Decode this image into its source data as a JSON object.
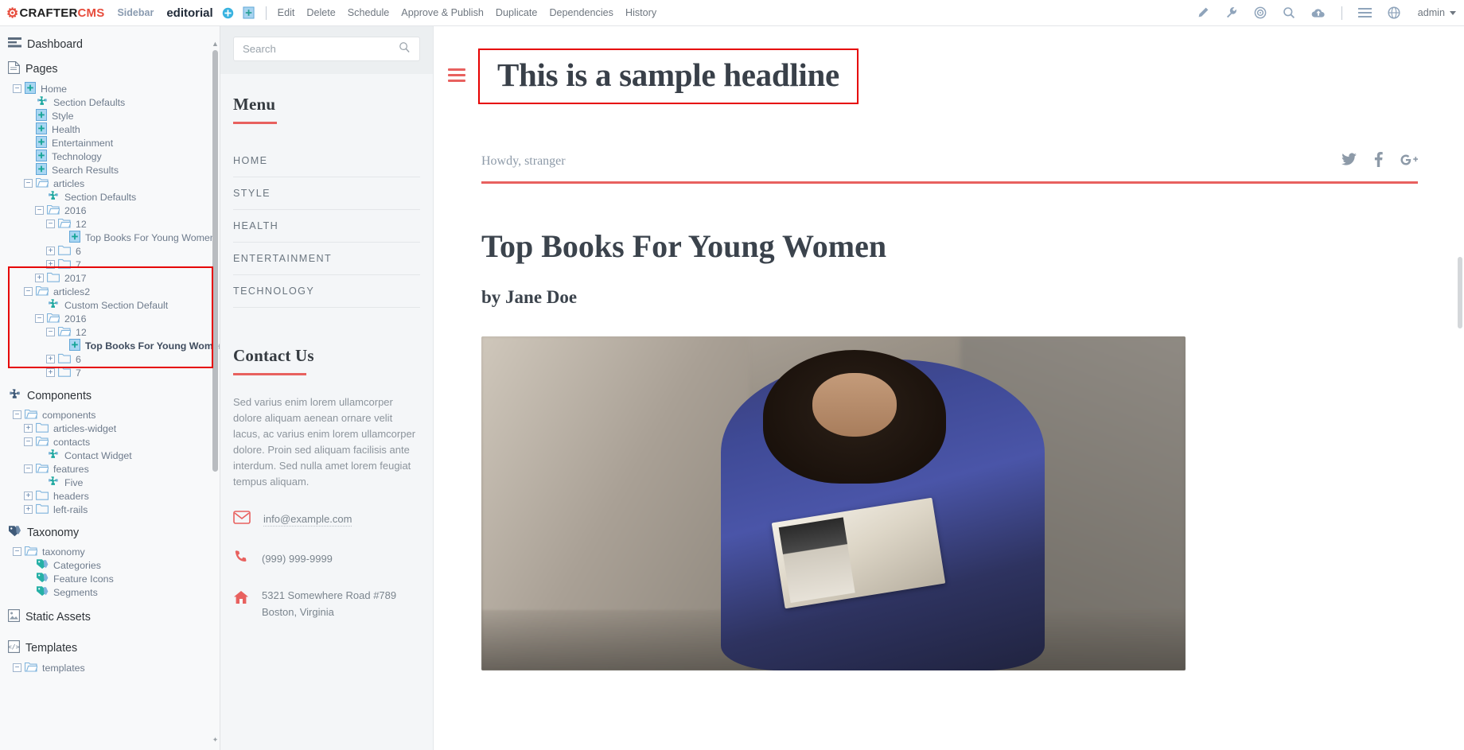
{
  "topbar": {
    "logo_crafter": "CRAFTER",
    "logo_cms": "CMS",
    "sidebar_label": "Sidebar",
    "site_name": "editorial",
    "add_icon": "circle-plus-icon",
    "new_page_icon": "new-page-icon",
    "menu": [
      "Edit",
      "Delete",
      "Schedule",
      "Approve & Publish",
      "Duplicate",
      "Dependencies",
      "History"
    ],
    "right_icons": [
      "pencil-icon",
      "wrench-icon",
      "target-icon",
      "search-icon",
      "cloud-upload-icon",
      "hamburger-icon",
      "globe-help-icon"
    ],
    "admin_label": "admin"
  },
  "tree": {
    "dashboard": "Dashboard",
    "pages_label": "Pages",
    "components_label": "Components",
    "taxonomy_label": "Taxonomy",
    "static_assets_label": "Static Assets",
    "templates_label": "Templates",
    "pages": [
      {
        "label": "Home",
        "depth": 1,
        "toggle": "minus",
        "icon": "page-icon"
      },
      {
        "label": "Section Defaults",
        "depth": 2,
        "toggle": "none",
        "icon": "component-icon"
      },
      {
        "label": "Style",
        "depth": 2,
        "toggle": "none",
        "icon": "page-icon"
      },
      {
        "label": "Health",
        "depth": 2,
        "toggle": "none",
        "icon": "page-icon"
      },
      {
        "label": "Entertainment",
        "depth": 2,
        "toggle": "none",
        "icon": "page-icon"
      },
      {
        "label": "Technology",
        "depth": 2,
        "toggle": "none",
        "icon": "page-icon"
      },
      {
        "label": "Search Results",
        "depth": 2,
        "toggle": "none",
        "icon": "page-icon"
      },
      {
        "label": "articles",
        "depth": 2,
        "toggle": "minus",
        "icon": "folder-open-icon"
      },
      {
        "label": "Section Defaults",
        "depth": 3,
        "toggle": "none",
        "icon": "component-icon"
      },
      {
        "label": "2016",
        "depth": 3,
        "toggle": "minus",
        "icon": "folder-open-icon"
      },
      {
        "label": "12",
        "depth": 4,
        "toggle": "minus",
        "icon": "folder-open-icon"
      },
      {
        "label": "Top Books For Young Women",
        "depth": 5,
        "toggle": "none",
        "icon": "page-icon"
      },
      {
        "label": "6",
        "depth": 4,
        "toggle": "plus",
        "icon": "folder-closed-icon"
      },
      {
        "label": "7",
        "depth": 4,
        "toggle": "plus",
        "icon": "folder-closed-icon"
      },
      {
        "label": "2017",
        "depth": 3,
        "toggle": "plus",
        "icon": "folder-closed-icon"
      },
      {
        "label": "articles2",
        "depth": 2,
        "toggle": "minus",
        "icon": "folder-open-icon"
      },
      {
        "label": "Custom Section Default",
        "depth": 3,
        "toggle": "none",
        "icon": "component-icon"
      },
      {
        "label": "2016",
        "depth": 3,
        "toggle": "minus",
        "icon": "folder-open-icon"
      },
      {
        "label": "12",
        "depth": 4,
        "toggle": "minus",
        "icon": "folder-open-icon"
      },
      {
        "label": "Top Books For Young Women",
        "depth": 5,
        "toggle": "none",
        "icon": "page-icon",
        "bold": true
      },
      {
        "label": "6",
        "depth": 4,
        "toggle": "plus",
        "icon": "folder-closed-icon"
      },
      {
        "label": "7",
        "depth": 4,
        "toggle": "plus",
        "icon": "folder-closed-icon"
      }
    ],
    "components": [
      {
        "label": "components",
        "depth": 1,
        "toggle": "minus",
        "icon": "folder-open-icon"
      },
      {
        "label": "articles-widget",
        "depth": 2,
        "toggle": "plus",
        "icon": "folder-closed-icon"
      },
      {
        "label": "contacts",
        "depth": 2,
        "toggle": "minus",
        "icon": "folder-open-icon"
      },
      {
        "label": "Contact Widget",
        "depth": 3,
        "toggle": "none",
        "icon": "component-icon"
      },
      {
        "label": "features",
        "depth": 2,
        "toggle": "minus",
        "icon": "folder-open-icon"
      },
      {
        "label": "Five",
        "depth": 3,
        "toggle": "none",
        "icon": "component-icon"
      },
      {
        "label": "headers",
        "depth": 2,
        "toggle": "plus",
        "icon": "folder-closed-icon"
      },
      {
        "label": "left-rails",
        "depth": 2,
        "toggle": "plus",
        "icon": "folder-closed-icon"
      }
    ],
    "taxonomy": [
      {
        "label": "taxonomy",
        "depth": 1,
        "toggle": "minus",
        "icon": "folder-open-icon"
      },
      {
        "label": "Categories",
        "depth": 2,
        "toggle": "none",
        "icon": "tag-icon"
      },
      {
        "label": "Feature Icons",
        "depth": 2,
        "toggle": "none",
        "icon": "tag-icon"
      },
      {
        "label": "Segments",
        "depth": 2,
        "toggle": "none",
        "icon": "tag-icon"
      }
    ],
    "templates": [
      {
        "label": "templates",
        "depth": 1,
        "toggle": "minus",
        "icon": "folder-open-icon"
      }
    ]
  },
  "rail": {
    "search_placeholder": "Search",
    "search_icon": "search-icon",
    "menu_heading": "Menu",
    "menu_items": [
      "HOME",
      "STYLE",
      "HEALTH",
      "ENTERTAINMENT",
      "TECHNOLOGY"
    ],
    "contact_heading": "Contact Us",
    "contact_text": "Sed varius enim lorem ullamcorper dolore aliquam aenean ornare velit lacus, ac varius enim lorem ullamcorper dolore. Proin sed aliquam facilisis ante interdum. Sed nulla amet lorem feugiat tempus aliquam.",
    "email": "info@example.com",
    "phone": "(999) 999-9999",
    "address": "5321 Somewhere Road #789",
    "address2": "Boston, Virginia"
  },
  "article": {
    "headline": "This is a sample headline",
    "burger_icon": "hamburger-icon",
    "howdy": "Howdy, stranger",
    "socials": [
      "twitter-icon",
      "facebook-icon",
      "google-plus-icon"
    ],
    "title": "Top Books For Young Women",
    "author": "by Jane Doe",
    "photo_alt": "woman-reading-book-photo"
  },
  "colors": {
    "accent_red": "#e8615f",
    "highlight_red": "#e60000",
    "brand_red": "#e74c3c",
    "tree_text": "#7b848d",
    "dark_text": "#394049"
  }
}
